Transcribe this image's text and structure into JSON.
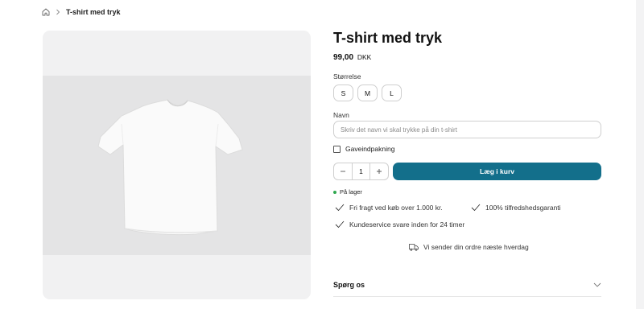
{
  "breadcrumb": {
    "current": "T-shirt med tryk"
  },
  "product": {
    "title": "T-shirt med tryk",
    "price": "99,00",
    "currency": "DKK"
  },
  "size": {
    "label": "Størrelse",
    "options": [
      "S",
      "M",
      "L"
    ]
  },
  "name_field": {
    "label": "Navn",
    "placeholder": "Skriv det navn vi skal trykke på din t-shirt",
    "value": ""
  },
  "gift": {
    "label": "Gaveindpakning",
    "checked": false
  },
  "quantity": {
    "value": "1"
  },
  "cart": {
    "button_label": "Læg i kurv"
  },
  "stock": {
    "label": "På lager",
    "color": "#2fa84f"
  },
  "perks": [
    "Fri fragt ved køb over 1.000 kr.",
    "100% tilfredshedsgaranti",
    "Kundeservice svare inden for 24 timer"
  ],
  "shipping": {
    "text": "Vi sender din ordre næste hverdag"
  },
  "faq": {
    "question": "Spørg os"
  },
  "colors": {
    "accent": "#136f8b"
  }
}
